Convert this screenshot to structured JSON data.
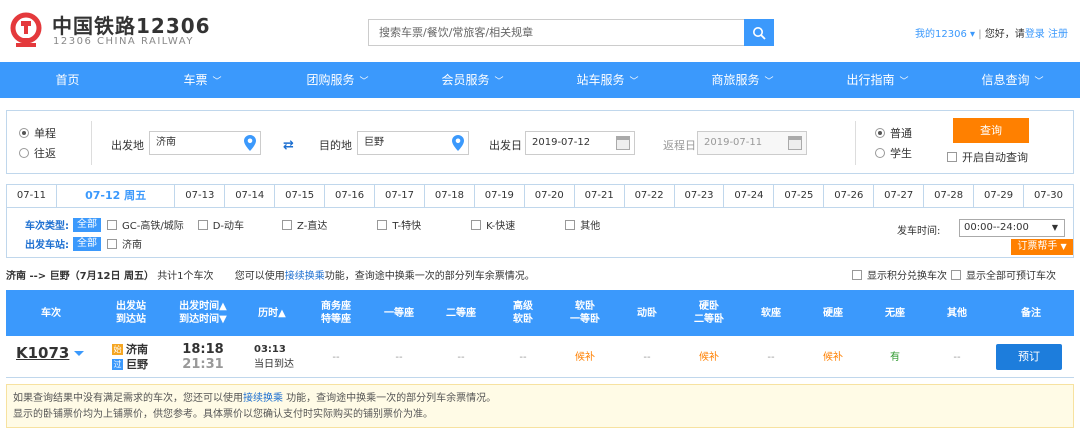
{
  "header": {
    "logo_cn": "中国铁路12306",
    "logo_en": "12306 CHINA RAILWAY",
    "search_placeholder": "搜索车票/餐饮/常旅客/相关规章",
    "my_12306": "我的12306",
    "greeting": "您好，请",
    "login": "登录",
    "register": "注册"
  },
  "nav": [
    {
      "label": "首页",
      "chevron": false
    },
    {
      "label": "车票",
      "chevron": true
    },
    {
      "label": "团购服务",
      "chevron": true
    },
    {
      "label": "会员服务",
      "chevron": true
    },
    {
      "label": "站车服务",
      "chevron": true
    },
    {
      "label": "商旅服务",
      "chevron": true
    },
    {
      "label": "出行指南",
      "chevron": true
    },
    {
      "label": "信息查询",
      "chevron": true
    }
  ],
  "query": {
    "one_way": "单程",
    "round_trip": "往返",
    "from_label": "出发地",
    "from_value": "济南",
    "to_label": "目的地",
    "to_value": "巨野",
    "depart_label": "出发日",
    "depart_value": "2019-07-12",
    "return_label": "返程日",
    "return_value": "2019-07-11",
    "normal": "普通",
    "student": "学生",
    "query_btn": "查询",
    "auto_query": "开启自动查询"
  },
  "dates": [
    "07-11",
    "07-12 周五",
    "07-13",
    "07-14",
    "07-15",
    "07-16",
    "07-17",
    "07-18",
    "07-19",
    "07-20",
    "07-21",
    "07-22",
    "07-23",
    "07-24",
    "07-25",
    "07-26",
    "07-27",
    "07-28",
    "07-29",
    "07-30"
  ],
  "filters": {
    "type_label": "车次类型:",
    "all": "全部",
    "types": [
      "GC-高铁/城际",
      "D-动车",
      "Z-直达",
      "T-特快",
      "K-快速",
      "其他"
    ],
    "station_label": "出发车站:",
    "stations": [
      "济南"
    ],
    "time_label": "发车时间:",
    "time_value": "00:00--24:00",
    "helper": "订票帮手"
  },
  "summary": {
    "route": "济南 --> 巨野（7月12日 周五）",
    "count": "共计1个车次",
    "tip_pre": "您可以使用",
    "tip_link": "接续换乘",
    "tip_post": "功能，查询途中换乘一次的部分列车余票情况。",
    "points_opt": "显示积分兑换车次",
    "all_opt": "显示全部可预订车次"
  },
  "table": {
    "headers": [
      [
        "车次"
      ],
      [
        "出发站",
        "到达站"
      ],
      [
        "出发时间▲",
        "到达时间▼"
      ],
      [
        "历时▲"
      ],
      [
        "商务座",
        "特等座"
      ],
      [
        "一等座"
      ],
      [
        "二等座"
      ],
      [
        "高级",
        "软卧"
      ],
      [
        "软卧",
        "一等卧"
      ],
      [
        "动卧"
      ],
      [
        "硬卧",
        "二等卧"
      ],
      [
        "软座"
      ],
      [
        "硬座"
      ],
      [
        "无座"
      ],
      [
        "其他"
      ],
      [
        "备注"
      ]
    ],
    "row": {
      "train": "K1073",
      "from_badge": "始",
      "from": "济南",
      "to_badge": "过",
      "to": "巨野",
      "dep_time": "18:18",
      "arr_time": "21:31",
      "duration": "03:13",
      "arrive_day": "当日到达",
      "business": "--",
      "first": "--",
      "second": "--",
      "senior_soft": "--",
      "soft_sleeper": "候补",
      "moving_sleeper": "--",
      "hard_sleeper": "候补",
      "soft_seat": "--",
      "hard_seat": "候补",
      "no_seat": "有",
      "other": "--",
      "book": "预订"
    }
  },
  "notice": {
    "line1_pre": "如果查询结果中没有满足需求的车次，您还可以使用",
    "line1_link": "接续换乘",
    "line1_post": " 功能，查询途中换乘一次的部分列车余票情况。",
    "line2": "显示的卧铺票价均为上铺票价，供您参考。具体票价以您确认支付时实际购买的铺别票价为准。"
  },
  "colors": {
    "primary": "#3b99fc",
    "accent": "#ff8000",
    "logo": "#e4393c"
  }
}
